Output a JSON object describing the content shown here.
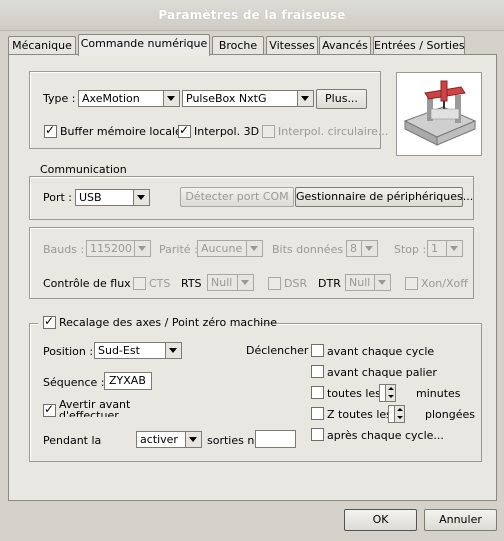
{
  "window": {
    "title": "Paramètres de la fraiseuse"
  },
  "tabs": [
    {
      "label": "Mécanique"
    },
    {
      "label": "Commande numérique"
    },
    {
      "label": "Broche"
    },
    {
      "label": "Vitesses"
    },
    {
      "label": "Avancés"
    },
    {
      "label": "Entrées / Sorties"
    }
  ],
  "controller": {
    "type_label": "Type :",
    "type_value": "AxeMotion",
    "model_value": "PulseBox NxtG",
    "more_button": "Plus...",
    "buffer_label": "Buffer mémoire locale..",
    "buffer_checked": true,
    "interp3d_label": "Interpol. 3D",
    "interp3d_checked": true,
    "interp_circ_label": "Interpol. circulaire...",
    "interp_circ_checked": false
  },
  "communication": {
    "group_label": "Communication",
    "port_label": "Port :",
    "port_value": "USB",
    "detect_button": "Détecter port COM",
    "devmgr_button": "Gestionnaire de périphériques..."
  },
  "serial": {
    "bauds_label": "Bauds :",
    "bauds_value": "115200",
    "parity_label": "Parité :",
    "parity_value": "Aucune",
    "databits_label": "Bits données :",
    "databits_value": "8",
    "stop_label": "Stop :",
    "stop_value": "1",
    "flow_label": "Contrôle de flux :",
    "cts_label": "CTS",
    "rts_label": "RTS",
    "rts_value": "Null",
    "dsr_label": "DSR",
    "dtr_label": "DTR",
    "dtr_value": "Null",
    "xon_label": "Xon/Xoff"
  },
  "homing": {
    "group_label": "Recalage des axes / Point zéro machine",
    "enabled": true,
    "position_label": "Position :",
    "position_value": "Sud-Est",
    "sequence_label": "Séquence :",
    "sequence_value": "ZYXAB",
    "warn_label_line1": "Avertir avant",
    "warn_label_line2": "d'effectuer",
    "warn_checked": true,
    "during_label": "Pendant la",
    "during_value": "activer",
    "outputs_label": "sorties n",
    "outputs_value": "",
    "trigger_label": "Déclencher",
    "before_cycle": "avant chaque cycle",
    "before_level": "avant chaque palier",
    "every_label": "toutes les",
    "minutes_label": "minutes",
    "z_every_label": "Z toutes les",
    "plunges_label": "plongées",
    "after_cycle": "après chaque cycle..."
  },
  "footer": {
    "ok": "OK",
    "cancel": "Annuler"
  }
}
